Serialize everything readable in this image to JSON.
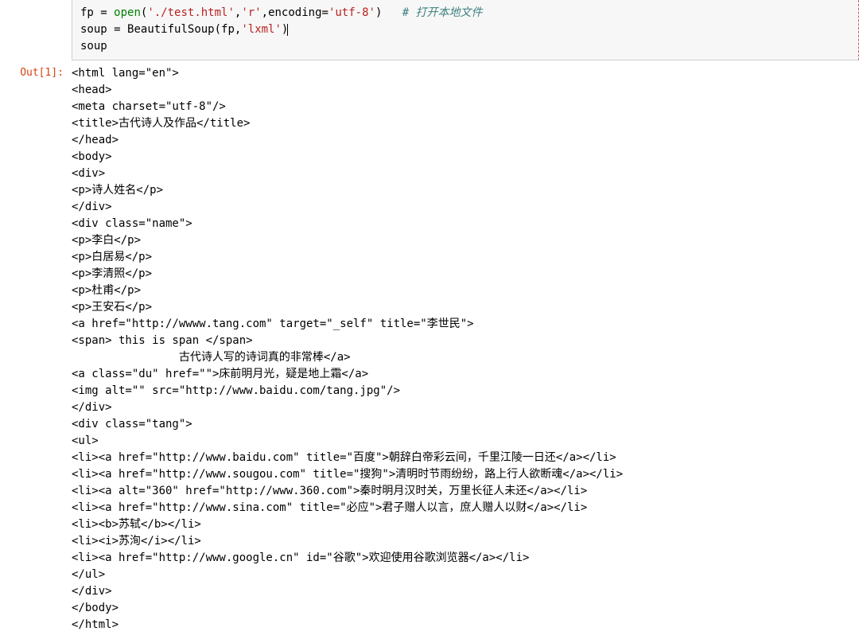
{
  "input_cell": {
    "line1": {
      "a": "fp ",
      "eq": "=",
      "sp1": " ",
      "open": "open",
      "lp": "(",
      "s1": "'./test.html'",
      "c1": ",",
      "s2": "'r'",
      "c2": ",",
      "kw": "encoding",
      "eq2": "=",
      "s3": "'utf-8'",
      "rp": ")   ",
      "comment": "# 打开本地文件"
    },
    "line2": {
      "a": "soup ",
      "eq": "=",
      "sp1": " ",
      "cls": "BeautifulSoup",
      "lp": "(",
      "arg1": "fp",
      "c1": ",",
      "s1": "'lxml'",
      "rp": ")"
    },
    "line3": "soup"
  },
  "output_prompt": "Out[1]:",
  "output_lines": [
    "<html lang=\"en\">",
    "<head>",
    "<meta charset=\"utf-8\"/>",
    "<title>古代诗人及作品</title>",
    "</head>",
    "<body>",
    "<div>",
    "<p>诗人姓名</p>",
    "</div>",
    "<div class=\"name\">",
    "<p>李白</p>",
    "<p>白居易</p>",
    "<p>李清照</p>",
    "<p>杜甫</p>",
    "<p>王安石</p>",
    "<a href=\"http://wwww.tang.com\" target=\"_self\" title=\"李世民\">",
    "<span> this is span </span>",
    "                古代诗人写的诗词真的非常棒</a>",
    "<a class=\"du\" href=\"\">床前明月光，疑是地上霜</a>",
    "<img alt=\"\" src=\"http://www.baidu.com/tang.jpg\"/>",
    "</div>",
    "<div class=\"tang\">",
    "<ul>",
    "<li><a href=\"http://www.baidu.com\" title=\"百度\">朝辞白帝彩云间，千里江陵一日还</a></li>",
    "<li><a href=\"http://www.sougou.com\" title=\"搜狗\">清明时节雨纷纷，路上行人欲断魂</a></li>",
    "<li><a alt=\"360\" href=\"http://www.360.com\">秦时明月汉时关，万里长征人未还</a></li>",
    "<li><a href=\"http://www.sina.com\" title=\"必应\">君子赠人以言，庶人赠人以财</a></li>",
    "<li><b>苏轼</b></li>",
    "<li><i>苏洵</i></li>",
    "<li><a href=\"http://www.google.cn\" id=\"谷歌\">欢迎使用谷歌浏览器</a></li>",
    "</ul>",
    "</div>",
    "</body>",
    "</html>"
  ]
}
